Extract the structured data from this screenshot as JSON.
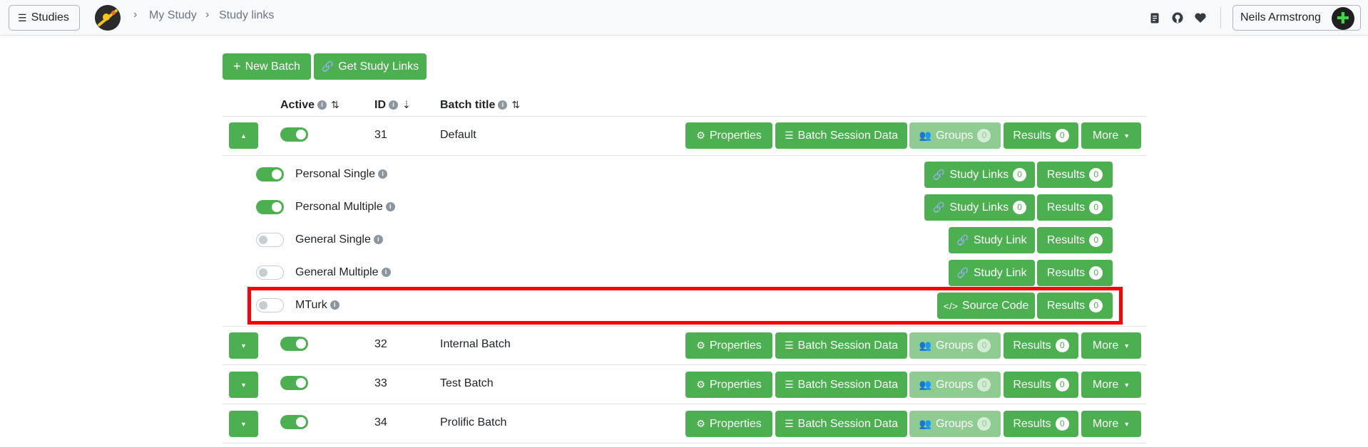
{
  "navbar": {
    "studies_label": "Studies",
    "breadcrumb": [
      "My Study",
      "Study links"
    ],
    "user_name": "Neils Armstrong"
  },
  "toolbar": {
    "new_batch": "New Batch",
    "get_links": "Get Study Links"
  },
  "table": {
    "headers": {
      "active": "Active",
      "id": "ID",
      "title": "Batch title"
    },
    "batch_buttons": {
      "properties": "Properties",
      "session_data": "Batch Session Data",
      "groups": "Groups",
      "results": "Results",
      "more": "More"
    },
    "batches": [
      {
        "id": "31",
        "title": "Default",
        "groups_count": "0",
        "results_count": "0",
        "active": true
      },
      {
        "id": "32",
        "title": "Internal Batch",
        "groups_count": "0",
        "results_count": "0",
        "active": true
      },
      {
        "id": "33",
        "title": "Test Batch",
        "groups_count": "0",
        "results_count": "0",
        "active": true
      },
      {
        "id": "34",
        "title": "Prolific Batch",
        "groups_count": "0",
        "results_count": "0",
        "active": true
      }
    ],
    "link_types": [
      {
        "name": "Personal Single",
        "active": true,
        "action": "Study Links",
        "action_count": "0",
        "results": "Results",
        "results_count": "0"
      },
      {
        "name": "Personal Multiple",
        "active": true,
        "action": "Study Links",
        "action_count": "0",
        "results": "Results",
        "results_count": "0"
      },
      {
        "name": "General Single",
        "active": false,
        "action": "Study Link",
        "results": "Results",
        "results_count": "0"
      },
      {
        "name": "General Multiple",
        "active": false,
        "action": "Study Link",
        "results": "Results",
        "results_count": "0"
      },
      {
        "name": "MTurk",
        "active": false,
        "action": "Source Code",
        "results": "Results",
        "results_count": "0"
      }
    ]
  },
  "colors": {
    "accent": "#4caf50",
    "accent_light": "#8fcc92",
    "highlight": "#ff0000"
  }
}
